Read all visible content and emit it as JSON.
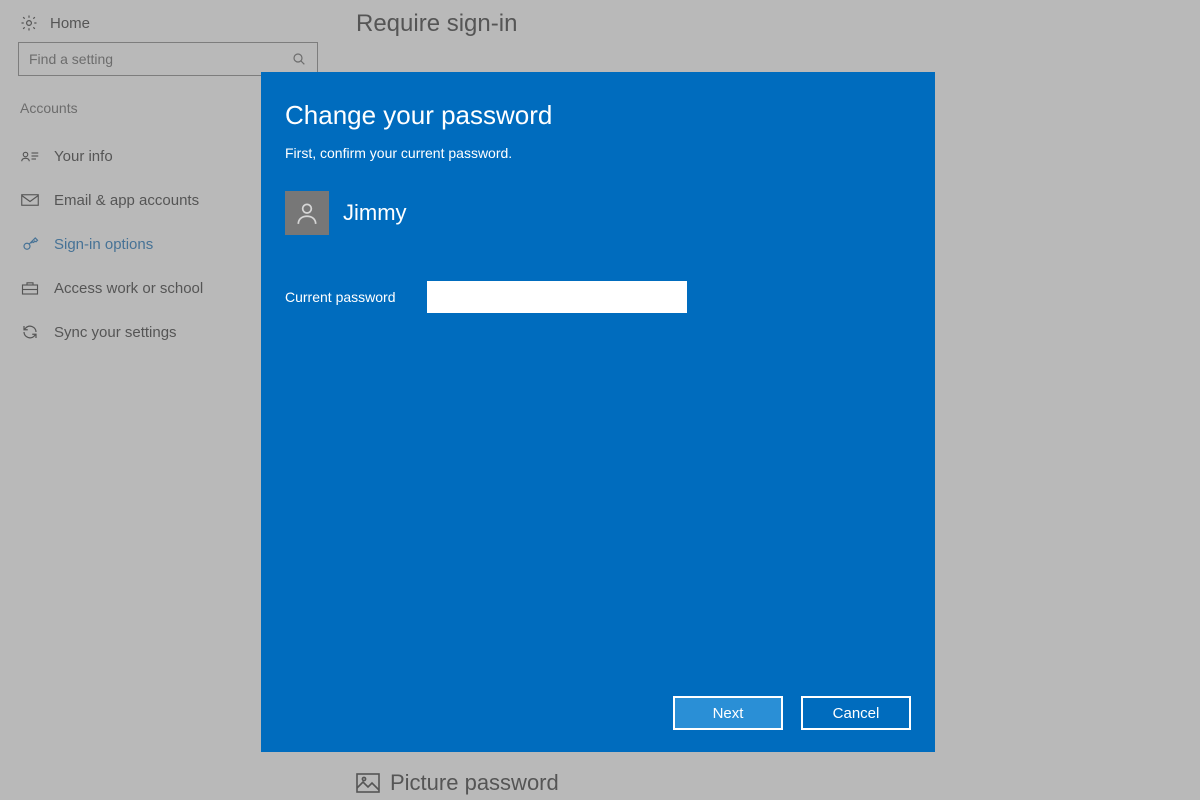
{
  "sidebar": {
    "home": "Home",
    "search_placeholder": "Find a setting",
    "section_label": "Accounts",
    "items": [
      {
        "label": "Your info"
      },
      {
        "label": "Email & app accounts"
      },
      {
        "label": "Sign-in options"
      },
      {
        "label": "Access work or school"
      },
      {
        "label": "Sync your settings"
      }
    ]
  },
  "main": {
    "heading": "Require sign-in",
    "picture_password": "Picture password"
  },
  "dialog": {
    "title": "Change your password",
    "subtitle": "First, confirm your current password.",
    "user_name": "Jimmy",
    "field_label": "Current password",
    "password_value": "",
    "next": "Next",
    "cancel": "Cancel"
  }
}
